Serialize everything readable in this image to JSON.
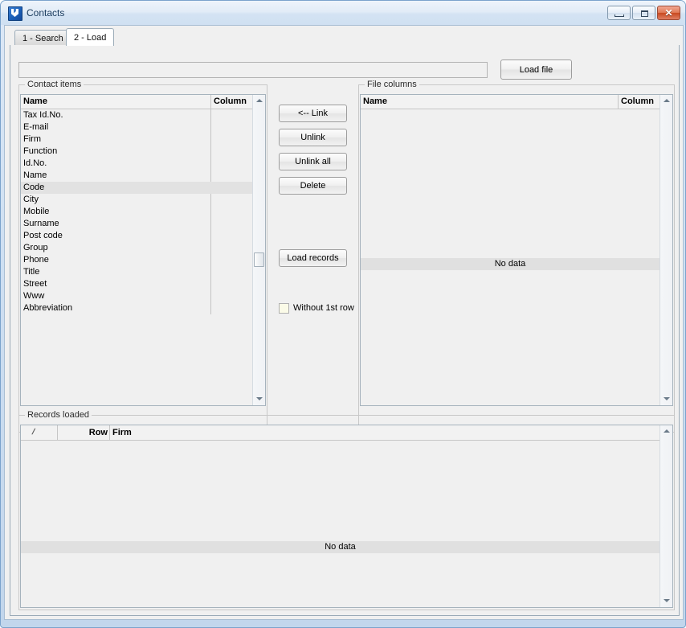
{
  "window": {
    "title": "Contacts",
    "icon": "app-icon",
    "buttons": {
      "minimize": "minimize",
      "maximize": "maximize",
      "close": "✕"
    }
  },
  "tabs": [
    {
      "label": "1 - Search",
      "selected": false
    },
    {
      "label": "2 - Load",
      "selected": true
    }
  ],
  "toolbar": {
    "path_value": "",
    "path_placeholder": "",
    "load_file_label": "Load file"
  },
  "contact_items": {
    "caption": "Contact items",
    "columns": [
      "Name",
      "Column"
    ],
    "selected_row": "Code",
    "rows": [
      {
        "name": "Tax Id.No.",
        "column": ""
      },
      {
        "name": "E-mail",
        "column": ""
      },
      {
        "name": "Firm",
        "column": ""
      },
      {
        "name": "Function",
        "column": ""
      },
      {
        "name": "Id.No.",
        "column": ""
      },
      {
        "name": "Name",
        "column": ""
      },
      {
        "name": "Code",
        "column": ""
      },
      {
        "name": "City",
        "column": ""
      },
      {
        "name": "Mobile",
        "column": ""
      },
      {
        "name": "Surname",
        "column": ""
      },
      {
        "name": "Post code",
        "column": ""
      },
      {
        "name": "Group",
        "column": ""
      },
      {
        "name": "Phone",
        "column": ""
      },
      {
        "name": "Title",
        "column": ""
      },
      {
        "name": "Street",
        "column": ""
      },
      {
        "name": "Www",
        "column": ""
      },
      {
        "name": "Abbreviation",
        "column": ""
      }
    ]
  },
  "actions": {
    "link_label": "<-- Link",
    "unlink_label": "Unlink",
    "unlink_all_label": "Unlink all",
    "delete_label": "Delete",
    "load_records_label": "Load records",
    "without_first_row_label": "Without 1st row",
    "without_first_row_checked": false
  },
  "file_columns": {
    "caption": "File columns",
    "columns": [
      "Name",
      "Column"
    ],
    "rows": [],
    "empty_text": "No data"
  },
  "records_loaded": {
    "caption": "Records loaded",
    "sort_marker": "/",
    "columns": [
      "Row",
      "Firm"
    ],
    "rows": [],
    "empty_text": "No data"
  },
  "colors": {
    "window_frame": "#7ba3cc",
    "titlebar_text": "#1b3c5e",
    "close_button": "#c8491f",
    "selection": "#e2e2e2",
    "nodata_band": "#e0e0e0",
    "client_bg": "#f0f0f0"
  }
}
